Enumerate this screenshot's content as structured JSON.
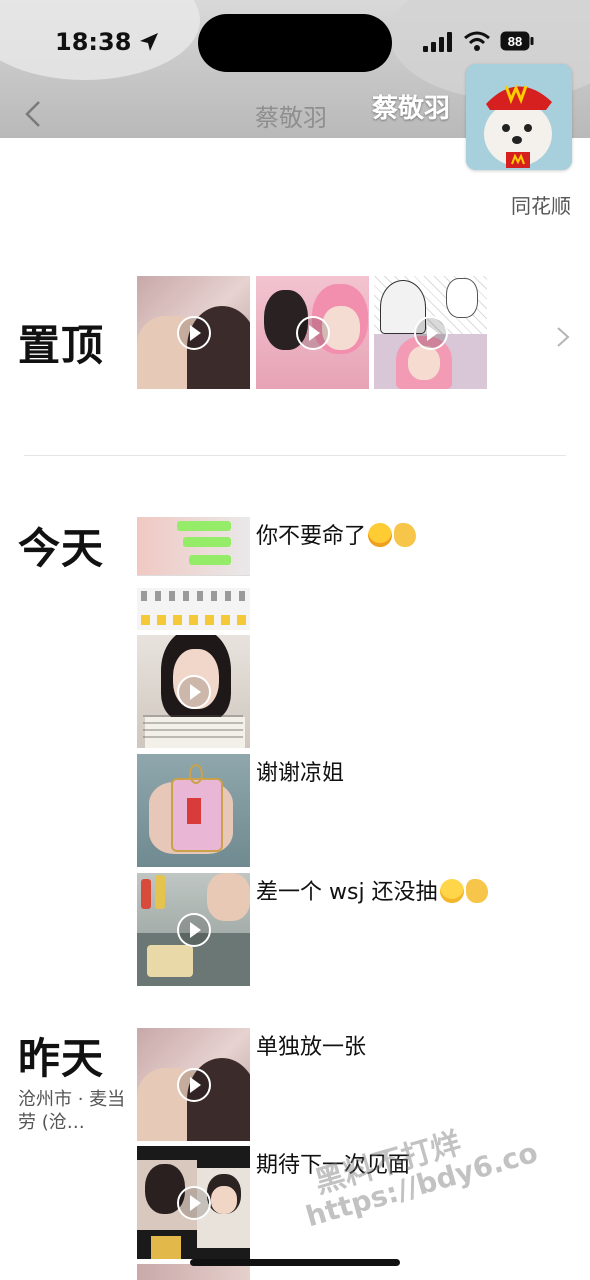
{
  "status_bar": {
    "time": "18:38",
    "battery": "88"
  },
  "header": {
    "title_faded": "蔡敬羽",
    "title": "蔡敬羽",
    "signature": "同花顺"
  },
  "pinned": {
    "label": "置顶"
  },
  "sections": [
    {
      "label": "今天",
      "location": "",
      "posts": [
        {
          "caption": "你不要命了",
          "video": false
        },
        {
          "caption": "",
          "video": true
        },
        {
          "caption": "谢谢凉姐",
          "video": false
        },
        {
          "caption": "差一个 wsj 还没抽",
          "video": true
        }
      ]
    },
    {
      "label": "昨天",
      "location": "沧州市 · 麦当劳 (沧…",
      "posts": [
        {
          "caption": "单独放一张",
          "video": true
        },
        {
          "caption": "期待下一次见面",
          "video": true
        }
      ]
    }
  ],
  "watermark": {
    "line1": "黑料不打烊",
    "line2": "https://bdy6.co"
  },
  "icons": [
    "back-icon",
    "location-arrow-icon",
    "signal-icon",
    "wifi-icon",
    "battery-icon",
    "play-icon",
    "chevron-right-icon",
    "laugh-emoji-icon",
    "smile-emoji-icon",
    "hand-emoji-icon"
  ]
}
